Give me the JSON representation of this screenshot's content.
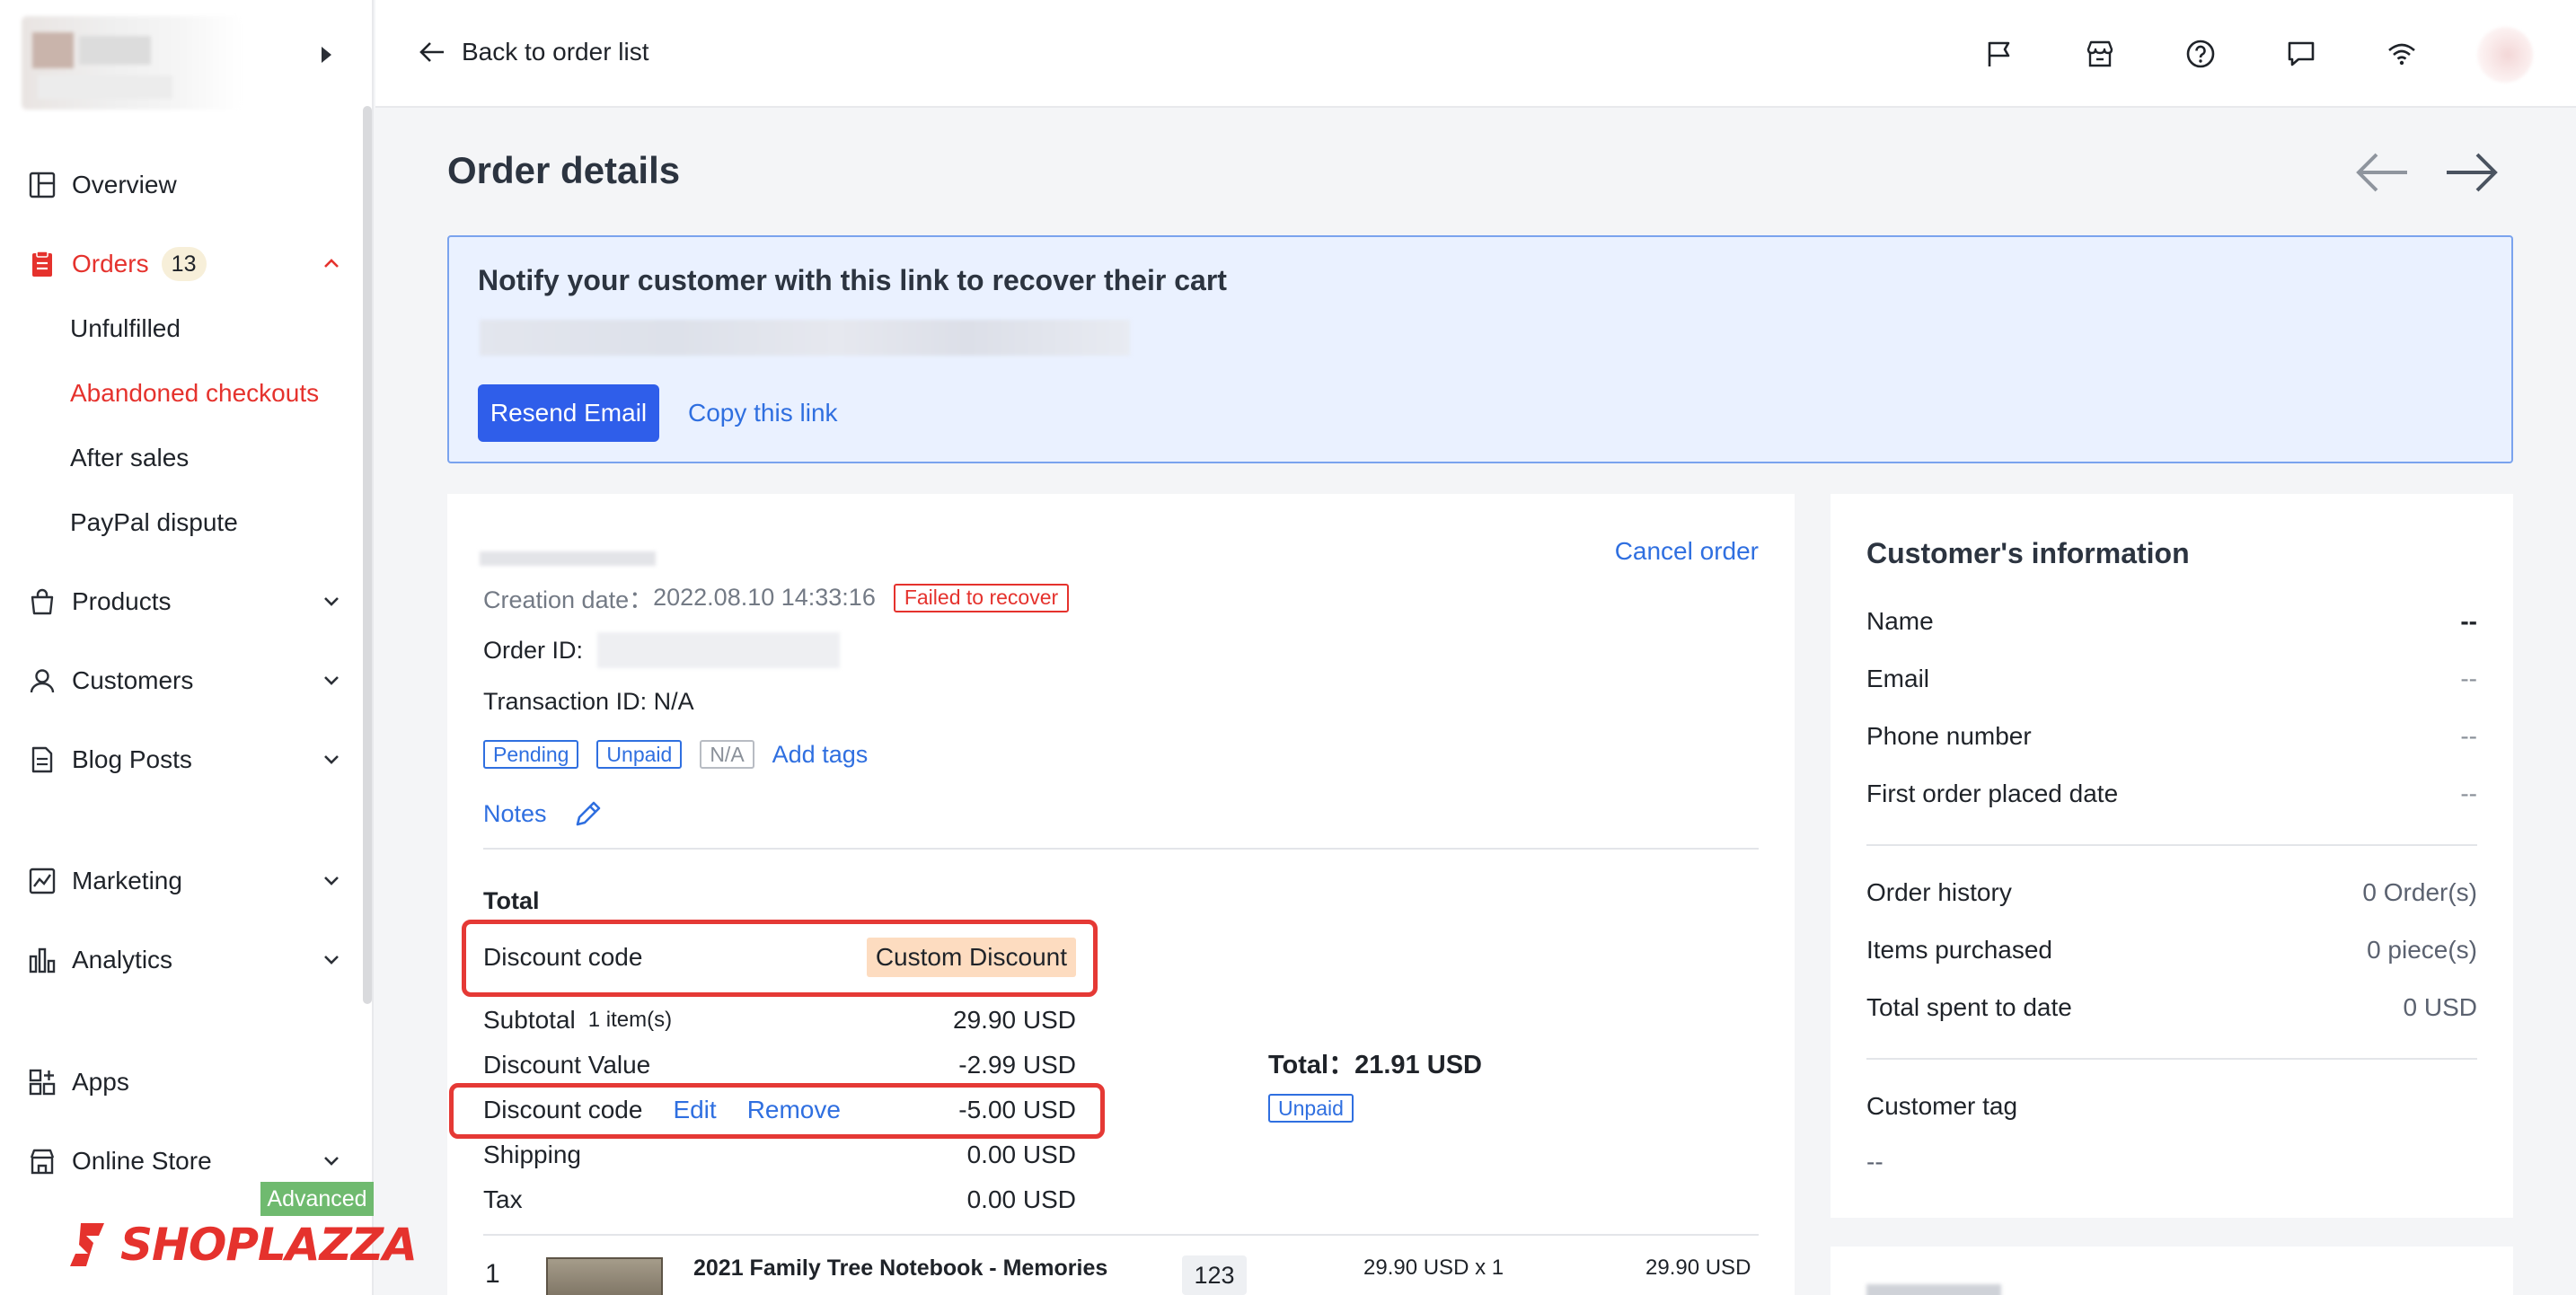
{
  "sidebar": {
    "nav": [
      {
        "label": "Overview",
        "icon": "overview-icon"
      },
      {
        "label": "Orders",
        "icon": "orders-icon",
        "badge": "13"
      },
      {
        "label": "Products",
        "icon": "products-icon"
      },
      {
        "label": "Customers",
        "icon": "customers-icon"
      },
      {
        "label": "Blog Posts",
        "icon": "blog-posts-icon"
      },
      {
        "label": "Marketing",
        "icon": "marketing-icon"
      },
      {
        "label": "Analytics",
        "icon": "analytics-icon"
      },
      {
        "label": "Apps",
        "icon": "apps-icon"
      },
      {
        "label": "Online Store",
        "icon": "online-store-icon"
      }
    ],
    "orders_sub": [
      {
        "label": "Unfulfilled"
      },
      {
        "label": "Abandoned checkouts"
      },
      {
        "label": "After sales"
      },
      {
        "label": "PayPal dispute"
      }
    ],
    "advanced_tag": "Advanced",
    "brand": "SHOPLAZZA"
  },
  "topbar": {
    "back_label": "Back to order list",
    "icons": [
      "flag-icon",
      "store-icon",
      "help-icon",
      "chat-icon",
      "wifi-icon"
    ]
  },
  "page": {
    "title": "Order details"
  },
  "notify": {
    "title": "Notify your customer with this link to recover their cart",
    "resend_label": "Resend Email",
    "copy_label": "Copy this link"
  },
  "order": {
    "cancel_label": "Cancel order",
    "creation_label": "Creation date：",
    "creation_value": "2022.08.10 14:33:16",
    "status_tag": "Failed to recover",
    "order_id_label": "Order ID:",
    "transaction_label": "Transaction ID: N/A",
    "tags": [
      "Pending",
      "Unpaid",
      "N/A"
    ],
    "add_tags_label": "Add tags",
    "notes_label": "Notes",
    "total_heading": "Total",
    "discount_code_label": "Discount code",
    "custom_discount": "Custom Discount",
    "subtotal_label": "Subtotal",
    "subtotal_items": "1 item(s)",
    "subtotal_value": "29.90 USD",
    "discount_value_label": "Discount Value",
    "discount_value": "-2.99 USD",
    "discount_code_label2": "Discount code",
    "edit_label": "Edit",
    "remove_label": "Remove",
    "discount_code_value": "-5.00 USD",
    "shipping_label": "Shipping",
    "shipping_value": "0.00 USD",
    "tax_label": "Tax",
    "tax_value": "0.00 USD",
    "grand_total": "Total：21.91 USD",
    "grand_status": "Unpaid",
    "product": {
      "index": "1",
      "name": "2021 Family Tree Notebook - Memories",
      "sku": "123",
      "price_qty": "29.90 USD x 1",
      "line_total": "29.90 USD"
    }
  },
  "customer": {
    "title": "Customer's information",
    "rows": [
      {
        "label": "Name",
        "value": "--"
      },
      {
        "label": "Email",
        "value": "--"
      },
      {
        "label": "Phone number",
        "value": "--"
      },
      {
        "label": "First order placed date",
        "value": "--"
      }
    ],
    "stats": [
      {
        "label": "Order history",
        "value": "0 Order(s)"
      },
      {
        "label": "Items purchased",
        "value": "0 piece(s)"
      },
      {
        "label": "Total spent to date",
        "value": "0 USD"
      }
    ],
    "tag_label": "Customer tag",
    "tag_value": "--"
  },
  "colors": {
    "brand_red": "#e5322d",
    "primary_blue": "#2f5eea",
    "link_blue": "#2f6fe0",
    "highlight_red": "#e53935",
    "chip_orange": "#fddcc0",
    "banner_bg": "#eaf1ff"
  }
}
